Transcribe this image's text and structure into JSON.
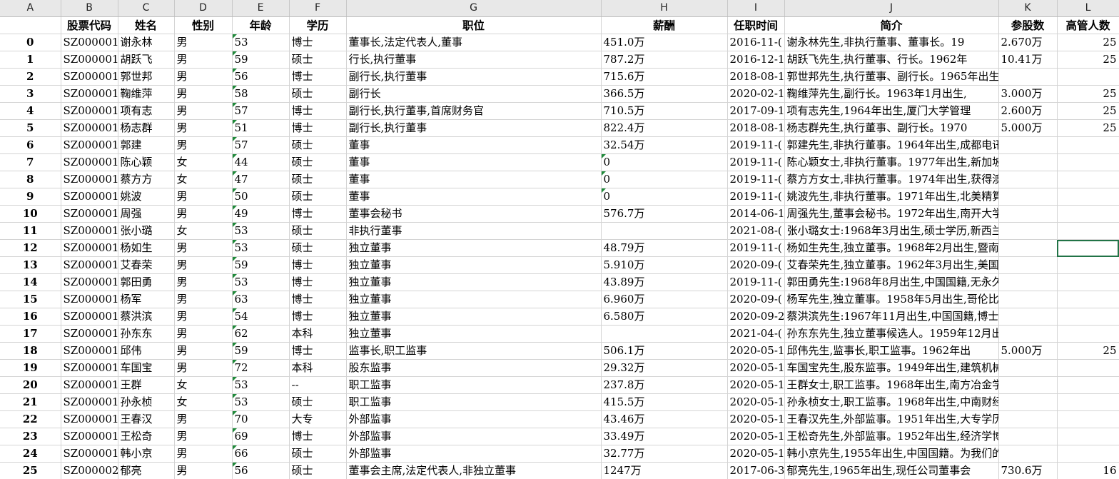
{
  "column_letters": [
    "A",
    "B",
    "C",
    "D",
    "E",
    "F",
    "G",
    "H",
    "I",
    "J",
    "K",
    "L"
  ],
  "headers": [
    "",
    "股票代码",
    "姓名",
    "性别",
    "年龄",
    "学历",
    "职位",
    "薪酬",
    "任职时间",
    "简介",
    "参股数",
    "高管人数"
  ],
  "rows": [
    [
      "0",
      "SZ000001",
      "谢永林",
      "男",
      "53",
      "博士",
      "董事长,法定代表人,董事",
      "451.0万",
      "2016-11-(",
      "谢永林先生,非执行董事、董事长。19",
      "2.670万",
      "25"
    ],
    [
      "1",
      "SZ000001",
      "胡跃飞",
      "男",
      "59",
      "硕士",
      "行长,执行董事",
      "787.2万",
      "2016-12-1",
      "胡跃飞先生,执行董事、行长。1962年",
      "10.41万",
      "25"
    ],
    [
      "2",
      "SZ000001",
      "郭世邦",
      "男",
      "56",
      "博士",
      "副行长,执行董事",
      "715.6万",
      "2018-08-1",
      "郭世邦先生,执行董事、副行长。1965年出生,北",
      "",
      ""
    ],
    [
      "3",
      "SZ000001",
      "鞠维萍",
      "男",
      "58",
      "硕士",
      "副行长",
      "366.5万",
      "2020-02-1",
      "鞠维萍先生,副行长。1963年1月出生,",
      "3.000万",
      "25"
    ],
    [
      "4",
      "SZ000001",
      "项有志",
      "男",
      "57",
      "博士",
      "副行长,执行董事,首席财务官",
      "710.5万",
      "2017-09-1",
      "项有志先生,1964年出生,厦门大学管理",
      "2.600万",
      "25"
    ],
    [
      "5",
      "SZ000001",
      "杨志群",
      "男",
      "51",
      "博士",
      "副行长,执行董事",
      "822.4万",
      "2018-08-1",
      "杨志群先生,执行董事、副行长。1970",
      "5.000万",
      "25"
    ],
    [
      "6",
      "SZ000001",
      "郭建",
      "男",
      "57",
      "硕士",
      "董事",
      "32.54万",
      "2019-11-(",
      "郭建先生,非执行董事。1964年出生,成都电讯工",
      "",
      ""
    ],
    [
      "7",
      "SZ000001",
      "陈心颖",
      "女",
      "44",
      "硕士",
      "董事",
      "0",
      "2019-11-(",
      "陈心颖女士,非执行董事。1977年出生,新加坡国",
      "",
      ""
    ],
    [
      "8",
      "SZ000001",
      "蔡方方",
      "女",
      "47",
      "硕士",
      "董事",
      "0",
      "2019-11-(",
      "蔡方方女士,非执行董事。1974年出生,获得澳大",
      "",
      ""
    ],
    [
      "9",
      "SZ000001",
      "姚波",
      "男",
      "50",
      "硕士",
      "董事",
      "0",
      "2019-11-(",
      "姚波先生,非执行董事。1971年出生,北美精算师",
      "",
      ""
    ],
    [
      "10",
      "SZ000001",
      "周强",
      "男",
      "49",
      "博士",
      "董事会秘书",
      "576.7万",
      "2014-06-1",
      "周强先生,董事会秘书。1972年出生,南开大学金",
      "",
      ""
    ],
    [
      "11",
      "SZ000001",
      "张小璐",
      "女",
      "53",
      "硕士",
      "非执行董事",
      "",
      "2021-08-(",
      "张小璐女士:1968年3月出生,硕士学历,新西兰梅",
      "",
      ""
    ],
    [
      "12",
      "SZ000001",
      "杨如生",
      "男",
      "53",
      "硕士",
      "独立董事",
      "48.79万",
      "2019-11-(",
      "杨如生先生,独立董事。1968年2月出生,暨南大学",
      "",
      ""
    ],
    [
      "13",
      "SZ000001",
      "艾春荣",
      "男",
      "59",
      "博士",
      "独立董事",
      "5.910万",
      "2020-09-(",
      "艾春荣先生,独立董事。1962年3月出生,美国麻省",
      "",
      ""
    ],
    [
      "14",
      "SZ000001",
      "郭田勇",
      "男",
      "53",
      "博士",
      "独立董事",
      "43.89万",
      "2019-11-(",
      "郭田勇先生:1968年8月出生,中国国籍,无永久境",
      "",
      ""
    ],
    [
      "15",
      "SZ000001",
      "杨军",
      "男",
      "63",
      "博士",
      "独立董事",
      "6.960万",
      "2020-09-(",
      "杨军先生,独立董事。1958年5月出生,哥伦比亚大",
      "",
      ""
    ],
    [
      "16",
      "SZ000001",
      "蔡洪滨",
      "男",
      "54",
      "博士",
      "独立董事",
      "6.580万",
      "2020-09-2",
      "蔡洪滨先生:1967年11月出生,中国国籍,博士学历",
      "",
      ""
    ],
    [
      "17",
      "SZ000001",
      "孙东东",
      "男",
      "62",
      "本科",
      "独立董事",
      "",
      "2021-04-(",
      "孙东东先生,独立董事候选人。1959年12月出生,",
      "",
      ""
    ],
    [
      "18",
      "SZ000001",
      "邱伟",
      "男",
      "59",
      "博士",
      "监事长,职工监事",
      "506.1万",
      "2020-05-1",
      "邱伟先生,监事长,职工监事。1962年出",
      "5.000万",
      "25"
    ],
    [
      "19",
      "SZ000001",
      "车国宝",
      "男",
      "72",
      "本科",
      "股东监事",
      "29.32万",
      "2020-05-1",
      "车国宝先生,股东监事。1949年出生,建筑机械专",
      "",
      ""
    ],
    [
      "20",
      "SZ000001",
      "王群",
      "女",
      "53",
      "--",
      "职工监事",
      "237.8万",
      "2020-05-1",
      "王群女士,职工监事。1968年出生,南方冶金学院",
      "",
      ""
    ],
    [
      "21",
      "SZ000001",
      "孙永桢",
      "女",
      "53",
      "硕士",
      "职工监事",
      "415.5万",
      "2020-05-1",
      "孙永桢女士,职工监事。1968年出生,中南财经政",
      "",
      ""
    ],
    [
      "22",
      "SZ000001",
      "王春汉",
      "男",
      "70",
      "大专",
      "外部监事",
      "43.46万",
      "2020-05-1",
      "王春汉先生,外部监事。1951年出生,大专学历,高",
      "",
      ""
    ],
    [
      "23",
      "SZ000001",
      "王松奇",
      "男",
      "69",
      "博士",
      "外部监事",
      "33.49万",
      "2020-05-1",
      "王松奇先生,外部监事。1952年出生,经济学博士",
      "",
      ""
    ],
    [
      "24",
      "SZ000001",
      "韩小京",
      "男",
      "66",
      "硕士",
      "外部监事",
      "32.77万",
      "2020-05-1",
      "韩小京先生,1955年出生,中国国籍。为我们的独",
      "",
      ""
    ],
    [
      "25",
      "SZ000002",
      "郁亮",
      "男",
      "56",
      "硕士",
      "董事会主席,法定代表人,非独立董事",
      "1247万",
      "2017-06-3",
      "郁亮先生,1965年出生,现任公司董事会",
      "730.6万",
      "16"
    ]
  ],
  "colors": {
    "header_bg": "#e8e8e8",
    "grid": "#d4d4d4",
    "mark": "#1f8a3a"
  }
}
